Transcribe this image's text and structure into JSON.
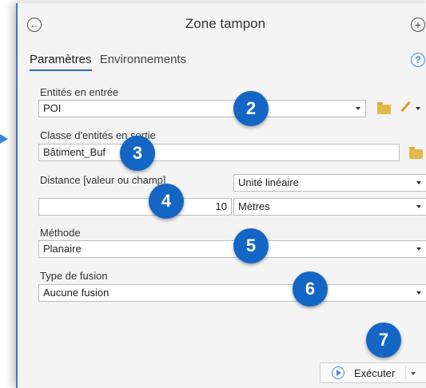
{
  "header": {
    "title": "Zone tampon",
    "back_icon": "back-arrow-circle-icon",
    "add_icon": "plus-circle-icon"
  },
  "tabs": [
    {
      "label": "Paramètres",
      "active": true
    },
    {
      "label": "Environnements",
      "active": false
    }
  ],
  "help_icon_glyph": "?",
  "form": {
    "input_features": {
      "label": "Entités en entrée",
      "value": "POI"
    },
    "output_features": {
      "label": "Classe d'entités en sortie",
      "value": "Bâtiment_Buf"
    },
    "distance": {
      "label": "Distance [valeur ou champ]",
      "value": "10"
    },
    "linear_unit": {
      "value": "Unité linéaire",
      "unit_value": "Mètres"
    },
    "method": {
      "label": "Méthode",
      "value": "Planaire"
    },
    "dissolve": {
      "label": "Type de fusion",
      "value": "Aucune fusion"
    }
  },
  "callouts": [
    "2",
    "3",
    "4",
    "5",
    "6",
    "7"
  ],
  "run_button": {
    "label": "Exécuter"
  },
  "colors": {
    "accent": "#1466c5",
    "pane_border": "#3c78c8",
    "folder": "#e6b84a"
  }
}
